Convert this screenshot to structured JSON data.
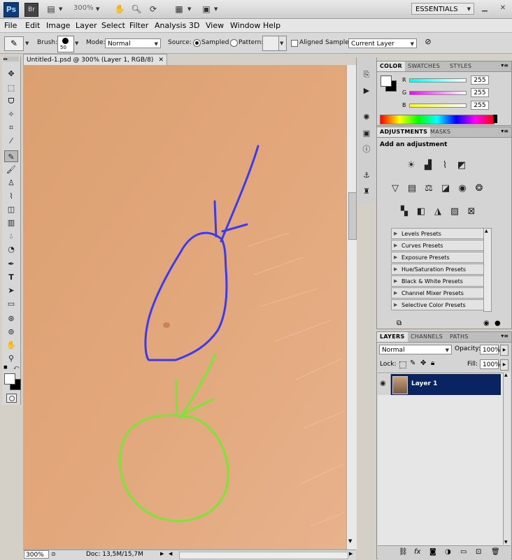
{
  "app": {
    "logo": "Ps",
    "bridge": "Br",
    "zoom": "300%",
    "workspace": "ESSENTIALS"
  },
  "menu": [
    "File",
    "Edit",
    "Image",
    "Layer",
    "Select",
    "Filter",
    "Analysis",
    "3D",
    "View",
    "Window",
    "Help"
  ],
  "options": {
    "brush_label": "Brush:",
    "brush_size": "50",
    "mode_label": "Mode:",
    "mode_value": "Normal",
    "source_label": "Source:",
    "sampled_label": "Sampled",
    "pattern_label": "Pattern:",
    "aligned_label": "Aligned",
    "sample_label": "Sample:",
    "sample_value": "Current Layer"
  },
  "document": {
    "tab_title": "Untitled-1.psd @ 300% (Layer 1, RGB/8)",
    "status_zoom": "300%",
    "status_doc": "Doc: 13,5M/15,7M"
  },
  "color_panel": {
    "tabs": [
      "COLOR",
      "SWATCHES",
      "STYLES"
    ],
    "channels": [
      {
        "label": "R",
        "value": "255"
      },
      {
        "label": "G",
        "value": "255"
      },
      {
        "label": "B",
        "value": "255"
      }
    ]
  },
  "adjustments_panel": {
    "tabs": [
      "ADJUSTMENTS",
      "MASKS"
    ],
    "heading": "Add an adjustment",
    "presets": [
      "Levels Presets",
      "Curves Presets",
      "Exposure Presets",
      "Hue/Saturation Presets",
      "Black & White Presets",
      "Channel Mixer Presets",
      "Selective Color Presets"
    ]
  },
  "layers_panel": {
    "tabs": [
      "LAYERS",
      "CHANNELS",
      "PATHS"
    ],
    "blend_mode": "Normal",
    "opacity_label": "Opacity:",
    "opacity": "100%",
    "lock_label": "Lock:",
    "fill_label": "Fill:",
    "fill": "100%",
    "layers": [
      {
        "name": "Layer 1"
      }
    ]
  },
  "colors": {
    "skin": "#e0a679",
    "blue_annotation": "#3a3af0",
    "green_annotation": "#78e632",
    "layer_selected": "#0a2463"
  }
}
